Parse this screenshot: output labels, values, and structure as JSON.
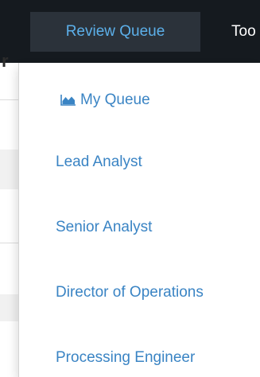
{
  "nav": {
    "tabs": [
      {
        "label": "Review Queue",
        "active": true
      },
      {
        "label": "Too",
        "active": false
      }
    ]
  },
  "background": {
    "partial_heading": "r"
  },
  "dropdown": {
    "items": [
      {
        "label": "My Queue",
        "icon": "area-chart-icon"
      },
      {
        "label": "Lead Analyst"
      },
      {
        "label": "Senior Analyst"
      },
      {
        "label": "Director of Operations"
      },
      {
        "label": "Processing Engineer"
      }
    ]
  },
  "colors": {
    "topbar": "#151a1f",
    "active_tab_bg": "#2b323a",
    "active_tab_text": "#5cb0ea",
    "link": "#3a84c4"
  }
}
